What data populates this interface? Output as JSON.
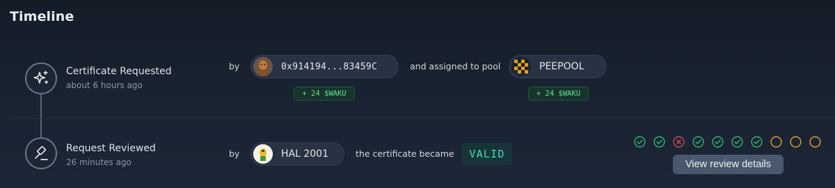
{
  "header": {
    "title": "Timeline"
  },
  "steps": [
    {
      "title": "Certificate Requested",
      "time": "about 6 hours ago",
      "icon": "sparkles-icon",
      "by_label": "by",
      "actor": {
        "label": "0x914194...83459C",
        "reward": "+ 24 $WAKU"
      },
      "connector_text": "and assigned to pool",
      "pool": {
        "label": "PEEPOOL",
        "reward": "+ 24 $WAKU"
      }
    },
    {
      "title": "Request Reviewed",
      "time": "26 minutes ago",
      "icon": "gavel-icon",
      "by_label": "by",
      "actor": {
        "label": "HAL 2001"
      },
      "result_text": "the certificate became",
      "result_value": "VALID",
      "votes": [
        "approve",
        "approve",
        "reject",
        "approve",
        "approve",
        "approve",
        "approve",
        "pending",
        "pending",
        "pending"
      ],
      "details_label": "View review details"
    }
  ],
  "colors": {
    "approve": "#2fb86a",
    "reject": "#d0485a",
    "pending": "#e0a030",
    "valid_text": "#3fe0b0",
    "reward_text": "#5ee08f"
  }
}
